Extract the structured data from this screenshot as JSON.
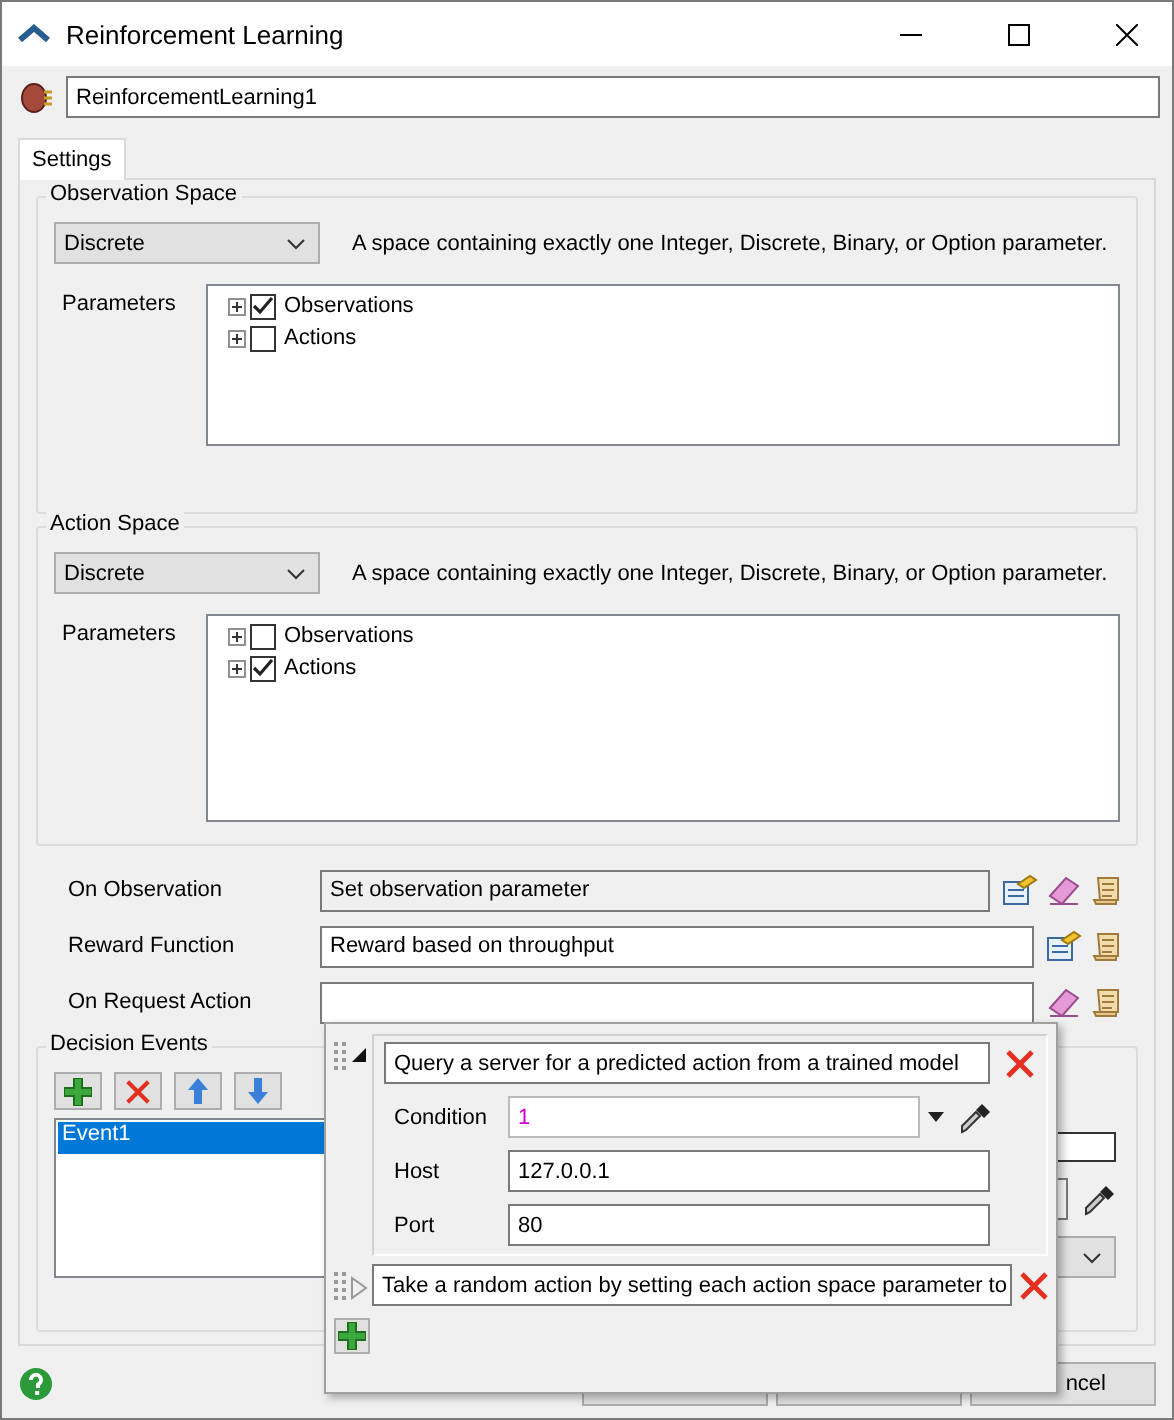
{
  "window": {
    "title": "Reinforcement Learning"
  },
  "object_name": {
    "value": "ReinforcementLearning1"
  },
  "tabs": [
    {
      "label": "Settings",
      "selected": true
    }
  ],
  "spaces": [
    {
      "title": "Observation Space",
      "type": "Discrete",
      "description": "A space containing exactly one Integer, Discrete, Binary, or Option parameter.",
      "parameters_label": "Parameters",
      "parameters": [
        {
          "label": "Observations",
          "checked": true
        },
        {
          "label": "Actions",
          "checked": false
        }
      ]
    },
    {
      "title": "Action Space",
      "type": "Discrete",
      "description": "A space containing exactly one Integer, Discrete, Binary, or Option parameter.",
      "parameters_label": "Parameters",
      "parameters": [
        {
          "label": "Observations",
          "checked": false
        },
        {
          "label": "Actions",
          "checked": true
        }
      ]
    }
  ],
  "triggers": [
    {
      "label": "On Observation",
      "value": "Set observation parameter",
      "kind": "readonly"
    },
    {
      "label": "Reward Function",
      "value": "Reward based on throughput",
      "kind": "editable"
    },
    {
      "label": "On Request Action",
      "kind": "editable"
    }
  ],
  "decision_events": {
    "title": "Decision Events",
    "events": [
      {
        "label": "Event1",
        "selected": true
      }
    ]
  },
  "popup": {
    "actions": [
      {
        "title": "Query a server for a predicted action from a trained model",
        "expanded": true,
        "fields": [
          {
            "label": "Condition",
            "value": "1",
            "kind": "condition"
          },
          {
            "label": "Host",
            "value": "127.0.0.1",
            "kind": "text"
          },
          {
            "label": "Port",
            "value": "80",
            "kind": "text"
          }
        ]
      },
      {
        "title": "Take a random action by setting each action space parameter to",
        "expanded": false
      }
    ]
  },
  "buttons": [
    {
      "label": "ncel"
    }
  ]
}
